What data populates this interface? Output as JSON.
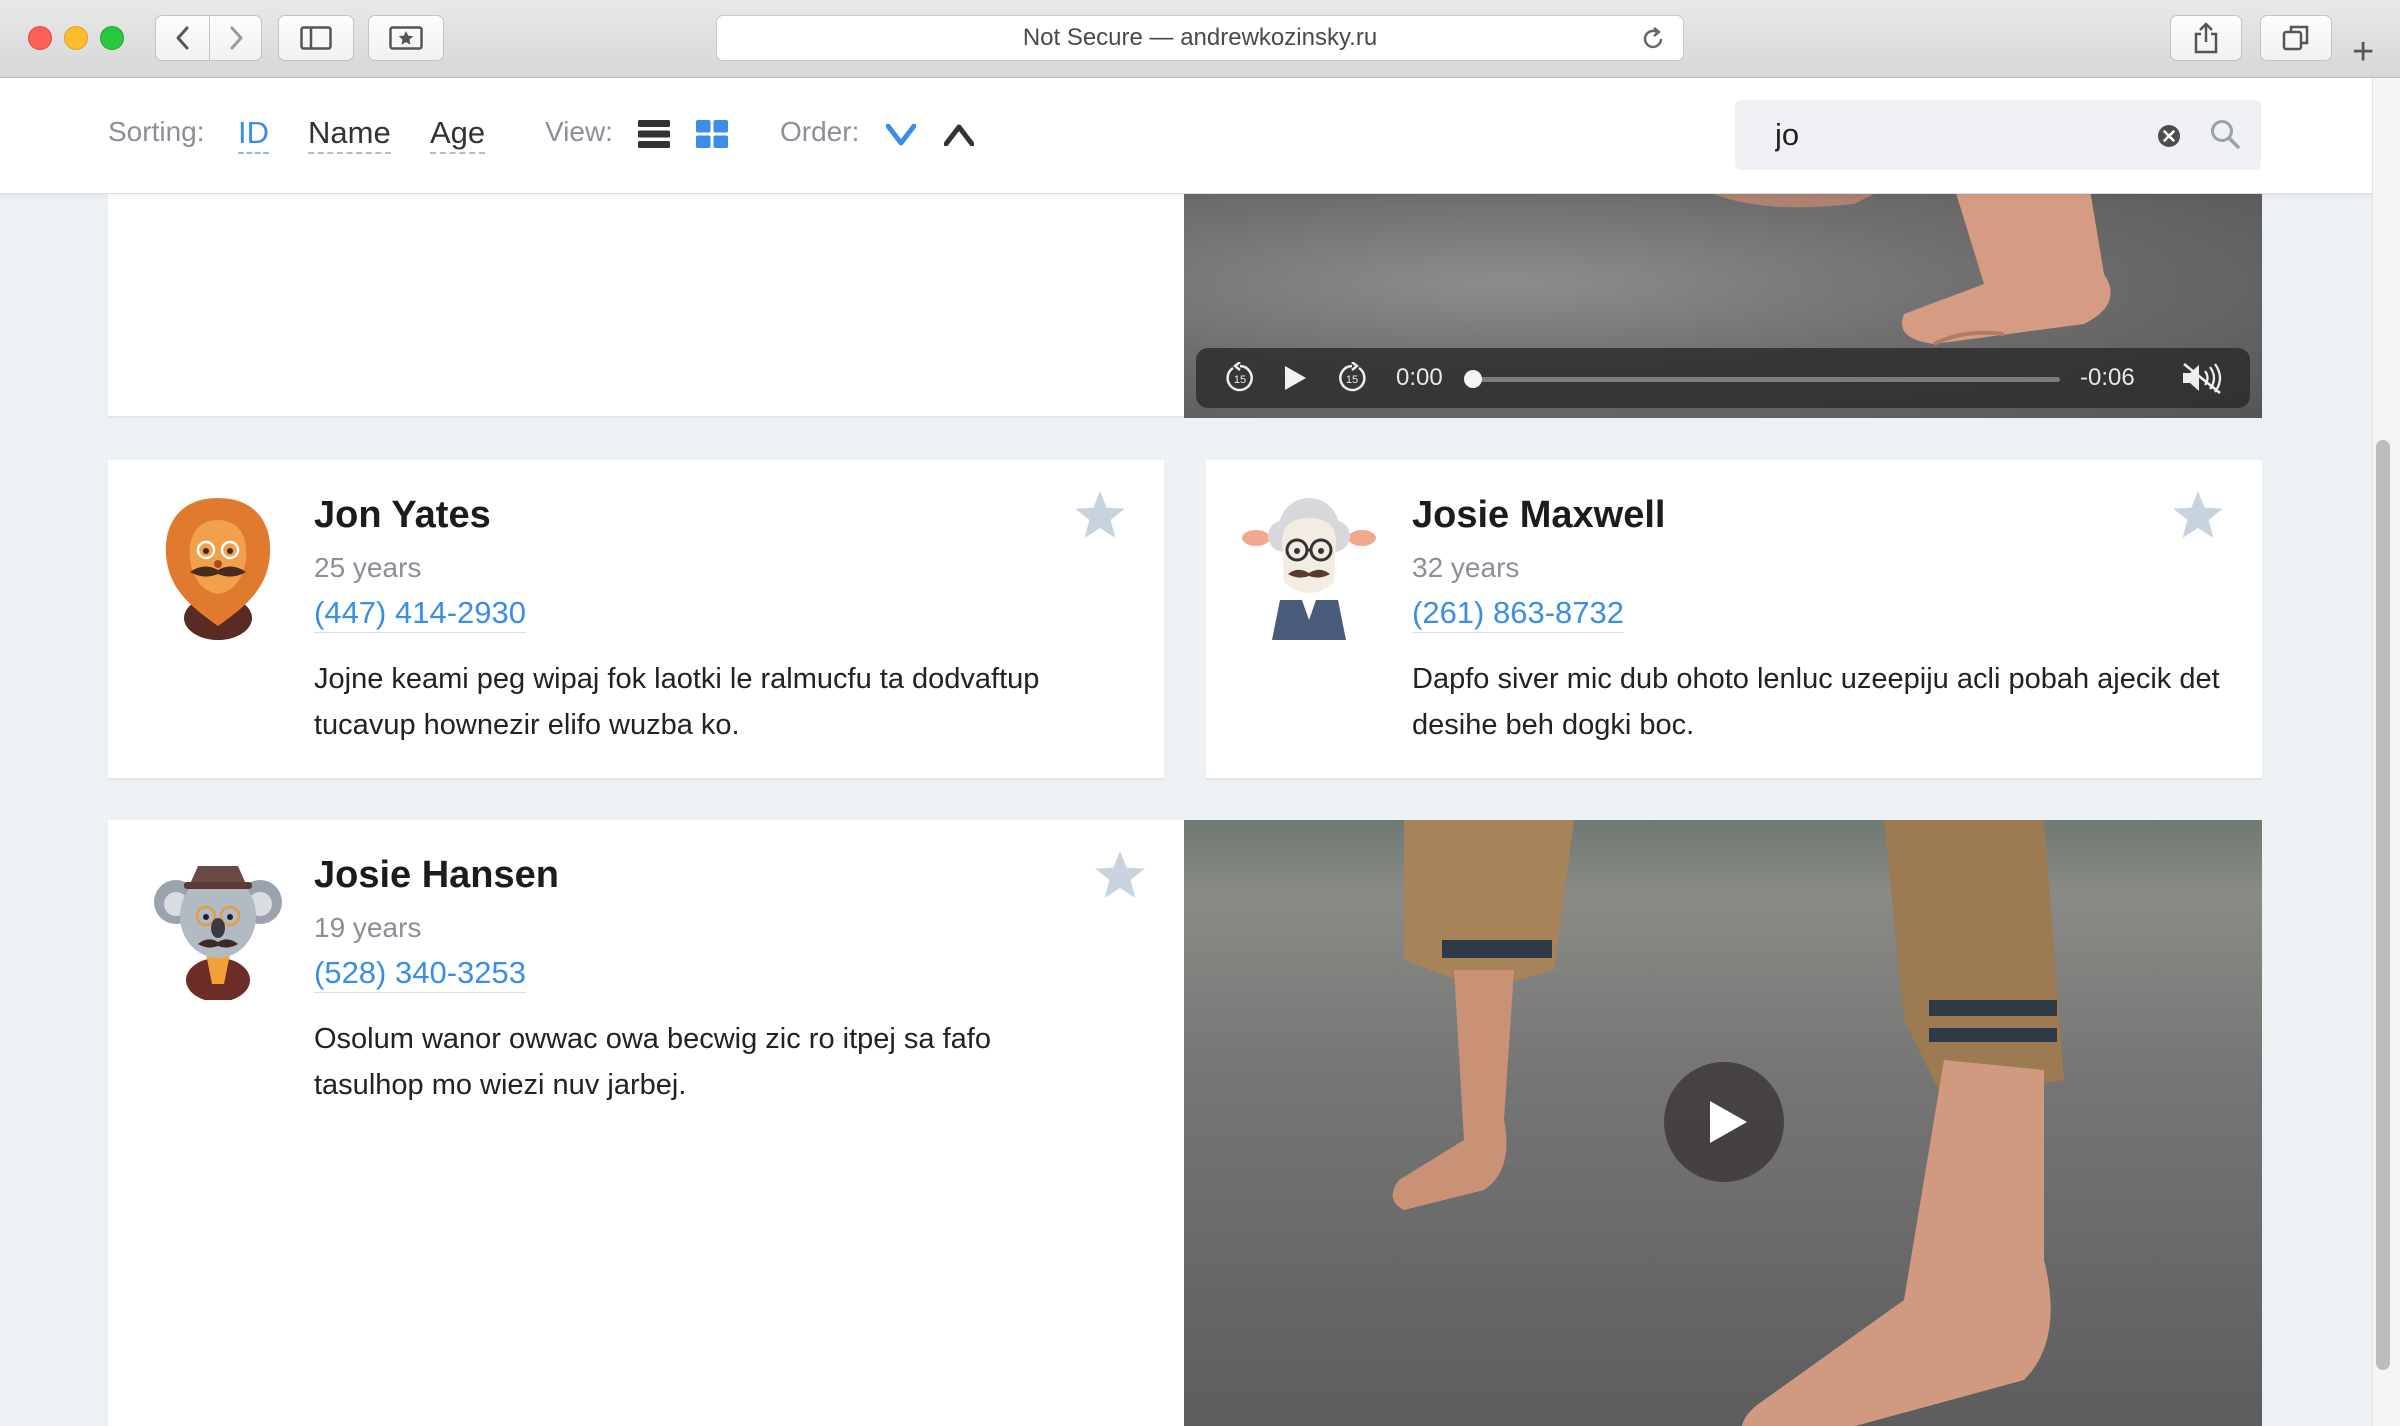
{
  "browser": {
    "address": "Not Secure — andrewkozinsky.ru",
    "new_tab_symbol": "+"
  },
  "toolbar": {
    "sorting_label": "Sorting:",
    "sort_options": [
      "ID",
      "Name",
      "Age"
    ],
    "sort_active": "ID",
    "view_label": "View:",
    "view_active": "grid",
    "order_label": "Order:",
    "order_active": "descending"
  },
  "search": {
    "value": "jo"
  },
  "video_top": {
    "current_time": "0:00",
    "remaining_time": "-0:06",
    "skip_back_seconds": "15",
    "skip_forward_seconds": "15",
    "muted": true,
    "progress": 0
  },
  "people": [
    {
      "name": "Jon Yates",
      "age": "25 years",
      "phone": "(447) 414-2930",
      "bio": "Jojne keami peg wipaj fok laotki le ralmucfu ta dodvaftup tucavup hownezir elifo wuzba ko.",
      "avatar": "lion-avatar"
    },
    {
      "name": "Josie Maxwell",
      "age": "32 years",
      "phone": "(261) 863-8732",
      "bio": "Dapfo siver mic dub ohoto lenluc uzeepiju acli pobah ajecik det desihe beh dogki boc.",
      "avatar": "sheep-avatar"
    },
    {
      "name": "Josie Hansen",
      "age": "19 years",
      "phone": "(528) 340-3253",
      "bio": "Osolum wanor owwac owa becwig zic ro itpej sa fafo tasulhop mo wiezi nuv jarbej.",
      "avatar": "koala-avatar"
    }
  ],
  "colors": {
    "accent": "#3a8ee6",
    "star": "#c9d3e0",
    "page_bg": "#eef1f4"
  }
}
